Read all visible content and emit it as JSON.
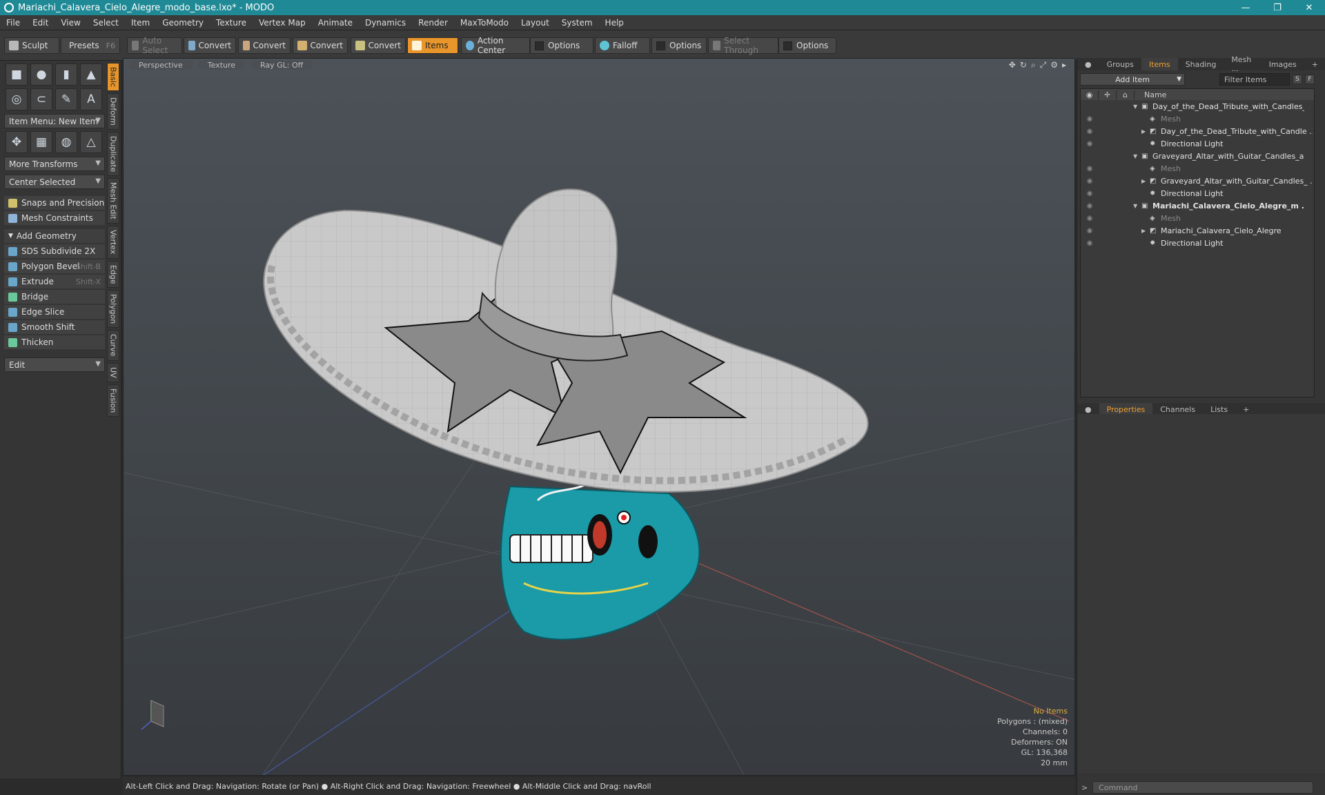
{
  "window": {
    "title": "Mariachi_Calavera_Cielo_Alegre_modo_base.lxo* - MODO"
  },
  "menu": [
    "File",
    "Edit",
    "View",
    "Select",
    "Item",
    "Geometry",
    "Texture",
    "Vertex Map",
    "Animate",
    "Dynamics",
    "Render",
    "MaxToModo",
    "Layout",
    "System",
    "Help"
  ],
  "toolbar": {
    "sculpt": "Sculpt",
    "presets": "Presets",
    "presets_hotkey": "F6",
    "auto_select": "Auto Select",
    "convert1": "Convert",
    "convert2": "Convert",
    "convert3": "Convert",
    "convert4": "Convert",
    "items": "Items",
    "action_center": "Action Center",
    "options1": "Options",
    "falloff": "Falloff",
    "options2": "Options",
    "select_through": "Select Through",
    "options3": "Options"
  },
  "left": {
    "item_menu": "Item Menu: New Item",
    "more_transforms": "More Transforms",
    "center_selected": "Center Selected",
    "snaps": "Snaps and Precision",
    "mesh_constraints": "Mesh Constraints",
    "add_geometry": "Add Geometry",
    "tools": [
      {
        "label": "SDS Subdivide 2X",
        "hotkey": ""
      },
      {
        "label": "Polygon Bevel",
        "hotkey": "Shift-B"
      },
      {
        "label": "Extrude",
        "hotkey": "Shift-X"
      },
      {
        "label": "Bridge",
        "hotkey": ""
      },
      {
        "label": "Edge Slice",
        "hotkey": ""
      },
      {
        "label": "Smooth Shift",
        "hotkey": ""
      },
      {
        "label": "Thicken",
        "hotkey": ""
      }
    ],
    "edit": "Edit",
    "vtabs": [
      "Basic",
      "Deform",
      "Duplicate",
      "Mesh Edit",
      "Vertex",
      "Edge",
      "Polygon",
      "Curve",
      "UV",
      "Fusion"
    ]
  },
  "viewport": {
    "perspective": "Perspective",
    "texture": "Texture",
    "raygl": "Ray GL: Off",
    "info": {
      "no_items": "No Items",
      "polygons": "Polygons : (mixed)",
      "channels": "Channels: 0",
      "deformers": "Deformers: ON",
      "gl": "GL: 136,368",
      "scale": "20 mm"
    }
  },
  "right": {
    "tabs": [
      "Groups",
      "Items",
      "Shading",
      "Mesh ...",
      "Images"
    ],
    "add_item": "Add Item",
    "filter_items": "Filter Items",
    "s_btn": "S",
    "f_btn": "F",
    "name_col": "Name",
    "rows": [
      {
        "label": "Day_of_the_Dead_Tribute_with_Candles_...",
        "expander": "▼",
        "icon": "▣",
        "indent": 0,
        "dim": false,
        "bold": false,
        "eye": ""
      },
      {
        "label": "Mesh",
        "expander": "",
        "icon": "◈",
        "indent": 1,
        "dim": true,
        "bold": false,
        "eye": "◉"
      },
      {
        "label": "Day_of_the_Dead_Tribute_with_Candle ...",
        "expander": "▶",
        "icon": "◩",
        "indent": 1,
        "dim": false,
        "bold": false,
        "eye": "◉"
      },
      {
        "label": "Directional Light",
        "expander": "",
        "icon": "✸",
        "indent": 1,
        "dim": false,
        "bold": false,
        "eye": "◉"
      },
      {
        "label": "Graveyard_Altar_with_Guitar_Candles_an ...",
        "expander": "▼",
        "icon": "▣",
        "indent": 0,
        "dim": false,
        "bold": false,
        "eye": ""
      },
      {
        "label": "Mesh",
        "expander": "",
        "icon": "◈",
        "indent": 1,
        "dim": true,
        "bold": false,
        "eye": "◉"
      },
      {
        "label": "Graveyard_Altar_with_Guitar_Candles_ ...",
        "expander": "▶",
        "icon": "◩",
        "indent": 1,
        "dim": false,
        "bold": false,
        "eye": "◉"
      },
      {
        "label": "Directional Light",
        "expander": "",
        "icon": "✸",
        "indent": 1,
        "dim": false,
        "bold": false,
        "eye": "◉"
      },
      {
        "label": "Mariachi_Calavera_Cielo_Alegre_m ...",
        "expander": "▼",
        "icon": "▣",
        "indent": 0,
        "dim": false,
        "bold": true,
        "eye": "◉"
      },
      {
        "label": "Mesh",
        "expander": "",
        "icon": "◈",
        "indent": 1,
        "dim": true,
        "bold": false,
        "eye": "◉"
      },
      {
        "label": "Mariachi_Calavera_Cielo_Alegre",
        "expander": "▶",
        "icon": "◩",
        "indent": 1,
        "dim": false,
        "bold": false,
        "eye": "◉"
      },
      {
        "label": "Directional Light",
        "expander": "",
        "icon": "✸",
        "indent": 1,
        "dim": false,
        "bold": false,
        "eye": "◉"
      }
    ],
    "props_tabs": [
      "Properties",
      "Channels",
      "Lists"
    ],
    "command": "Command"
  },
  "status": "Alt-Left Click and Drag: Navigation: Rotate (or Pan) ● Alt-Right Click and Drag: Navigation: Freewheel ● Alt-Middle Click and Drag: navRoll",
  "colors": {
    "accent": "#e8962b",
    "title_bar": "#1f8a96",
    "skull": "#1b9aa8"
  }
}
